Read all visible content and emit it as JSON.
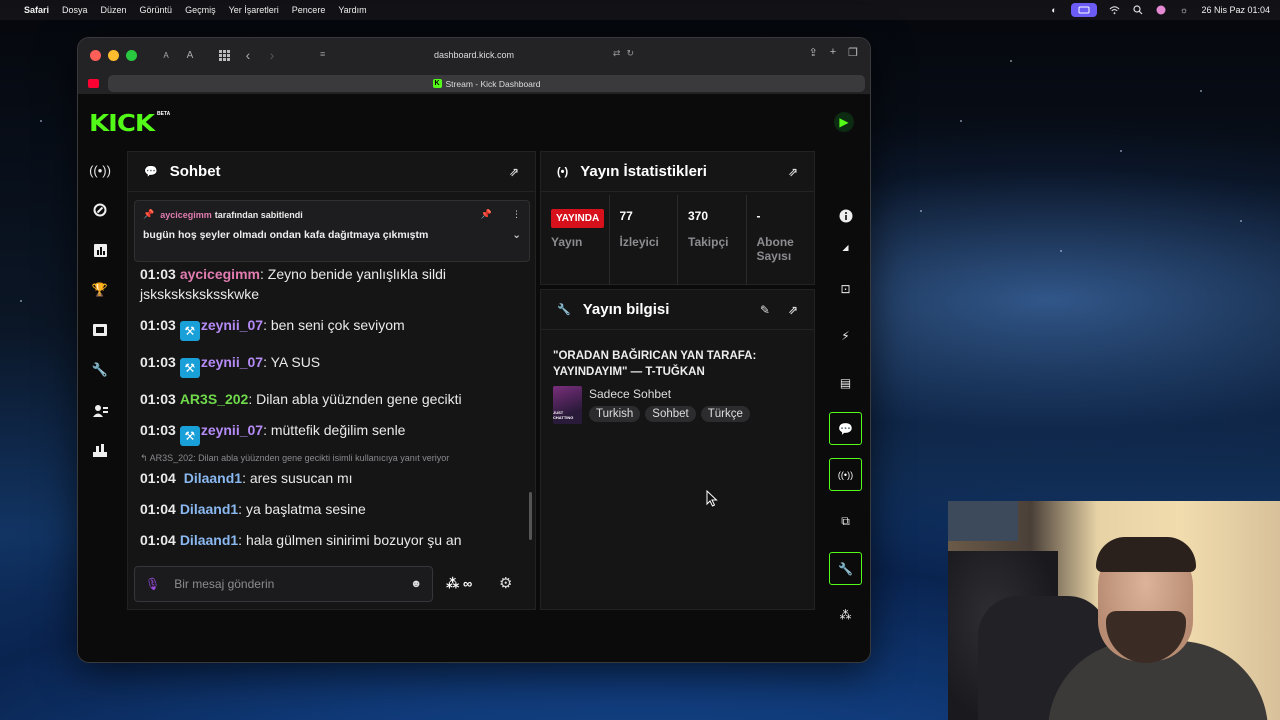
{
  "menubar": {
    "app": "Safari",
    "items": [
      "Dosya",
      "Düzen",
      "Görüntü",
      "Geçmiş",
      "Yer İşaretleri",
      "Pencere",
      "Yardım"
    ],
    "datetime": "26 Nis Paz  01:04"
  },
  "browser": {
    "url": "dashboard.kick.com",
    "tab_title": "Stream - Kick Dashboard",
    "text_size_small": "A",
    "text_size_large": "A"
  },
  "kick": {
    "logo": "KICK",
    "beta": "BETA"
  },
  "chat": {
    "title": "Sohbet",
    "pinned": {
      "user": "aycicegimm",
      "by_text": "tarafından sabitlendi",
      "message": "bugün hoş şeyler olmadı ondan kafa dağıtmaya çıkmıştm"
    },
    "messages": [
      {
        "time": "01:03",
        "user": "aycicegimm",
        "color": "#e17cb0",
        "badge": false,
        "text": ": Zeyno benide yanlışlıkla sildi jsksksksksksskwke"
      },
      {
        "time": "01:03",
        "user": "zeynii_07",
        "color": "#b58bf5",
        "badge": true,
        "text": ": ben seni çok seviyom"
      },
      {
        "time": "01:03",
        "user": "zeynii_07",
        "color": "#b58bf5",
        "badge": true,
        "text": ": YA SUS"
      },
      {
        "time": "01:03",
        "user": "AR3S_202",
        "color": "#6fd94a",
        "badge": false,
        "text": ": Dilan abla yüüznden gene gecikti"
      },
      {
        "time": "01:03",
        "user": "zeynii_07",
        "color": "#b58bf5",
        "badge": true,
        "text": ": müttefik değilim senle"
      },
      {
        "reply": "AR3S_202: Dilan abla yüüznden gene gecikti isimli kullanıcıya yanıt veriyor"
      },
      {
        "time": "01:04",
        "user": " Dilaand1",
        "color": "#8ab8f0",
        "badge": false,
        "text": ": ares susucan mı"
      },
      {
        "time": "01:04",
        "user": "Dilaand1",
        "color": "#8ab8f0",
        "badge": false,
        "text": ": ya başlatma sesine"
      },
      {
        "time": "01:04",
        "user": "Dilaand1",
        "color": "#8ab8f0",
        "badge": false,
        "text": ": hala gülmen sinirimi bozuyor şu an"
      }
    ],
    "input_placeholder": "Bir mesaj gönderin",
    "kicks_label": "∞"
  },
  "stats": {
    "title": "Yayın İstatistikleri",
    "live_label": "YAYINDA",
    "items": [
      {
        "value": "",
        "label": "Yayın"
      },
      {
        "value": "77",
        "label": "İzleyici"
      },
      {
        "value": "370",
        "label": "Takipçi"
      },
      {
        "value": "-",
        "label": "Abone Sayısı"
      }
    ]
  },
  "info": {
    "title": "Yayın bilgisi",
    "stream_title": "\"ORADAN BAĞIRICAN YAN TARAFA: YAYINDAYIM\" — T-TUĞKAN",
    "category": "Sadece Sohbet",
    "thumb_text": "JUST CHATTING",
    "tags": [
      "Turkish",
      "Sohbet",
      "Türkçe"
    ]
  },
  "colors": {
    "kick_green": "#53fc18",
    "live_red": "#d6111c"
  }
}
